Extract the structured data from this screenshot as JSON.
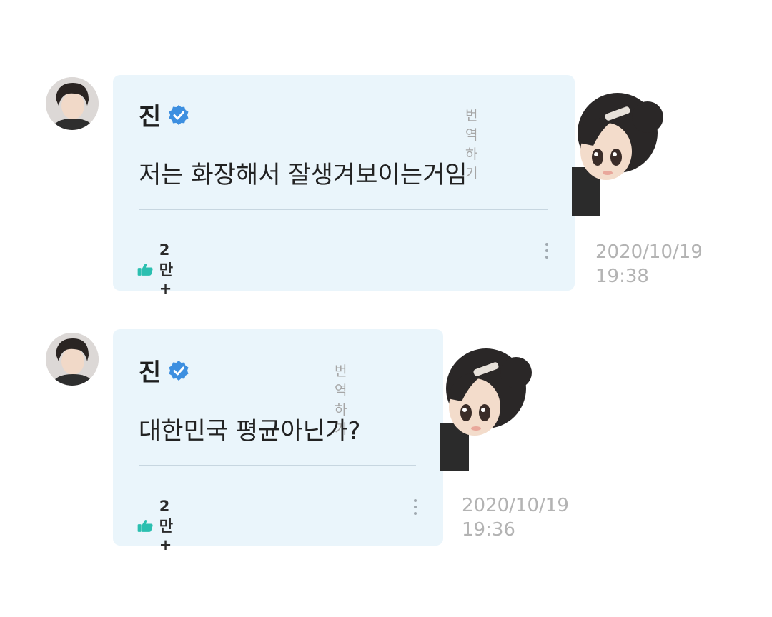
{
  "messages": [
    {
      "author": "진",
      "translate_label": "번역하기",
      "text": "저는 화장해서 잘생겨보이는거임",
      "likes": "2만+",
      "date": "2020/10/19",
      "time": "19:38"
    },
    {
      "author": "진",
      "translate_label": "번역하기",
      "text": "대한민국 평균아닌가?",
      "likes": "2만+",
      "date": "2020/10/19",
      "time": "19:36"
    }
  ],
  "colors": {
    "bubble": "#eaf5fb",
    "verified": "#3d8fe0",
    "like": "#2bbfb0"
  },
  "icons": [
    "avatar",
    "verified-badge-icon",
    "thumbs-up-icon",
    "more-vertical-icon",
    "character-sticker"
  ]
}
